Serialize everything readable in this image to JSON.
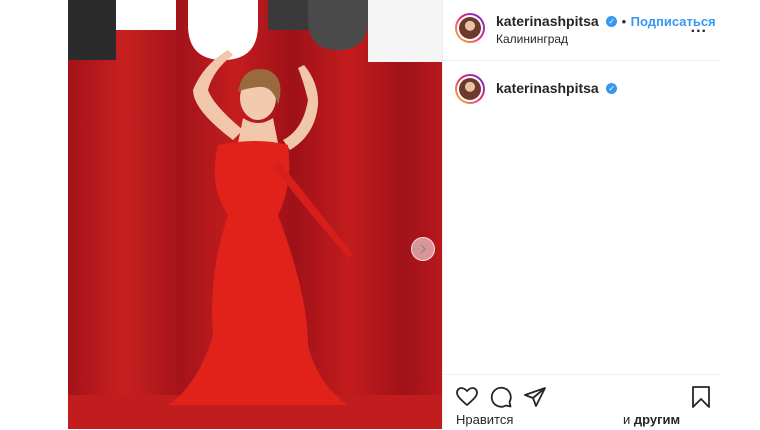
{
  "post": {
    "username": "katerinashpitsa",
    "separator": "•",
    "follow_label": "Подписаться",
    "location": "Калининград",
    "more_label": "..."
  },
  "caption": {
    "username": "katerinashpitsa"
  },
  "likes": {
    "left_label": "Нравится",
    "right_prefix": "и",
    "right_label": "другим"
  },
  "icons": [
    "heart-icon",
    "comment-icon",
    "share-icon",
    "bookmark-icon",
    "chevron-right-icon",
    "verified-icon"
  ],
  "colors": {
    "accent": "#3897f0",
    "dress": "#e0221b",
    "curtain": "#b8151a"
  }
}
